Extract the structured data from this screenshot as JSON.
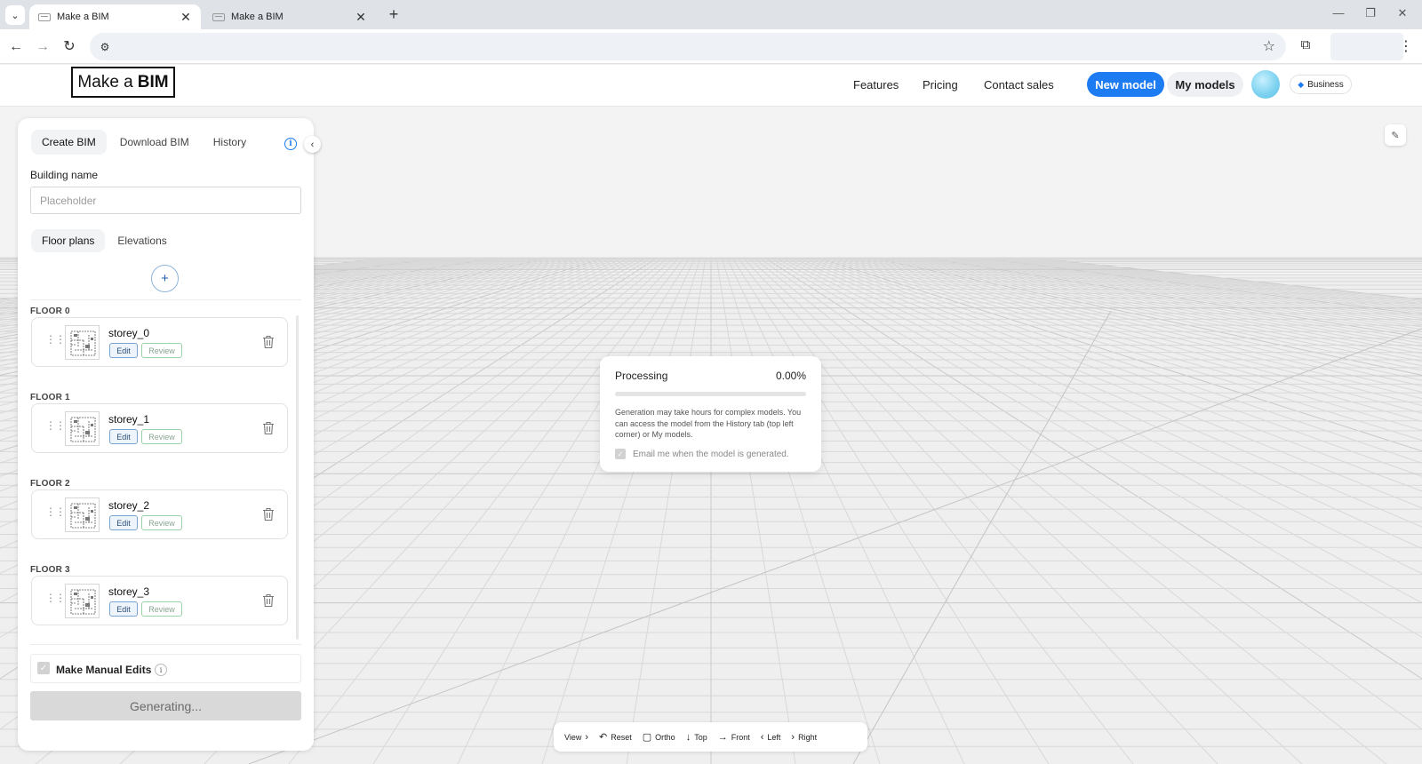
{
  "browser": {
    "tabs": [
      {
        "title": "Make a BIM",
        "active": true
      },
      {
        "title": "Make a BIM",
        "active": false
      }
    ]
  },
  "header": {
    "logo_text": "Make a",
    "logo_bold": "BIM",
    "nav": [
      "Features",
      "Pricing",
      "Contact sales"
    ],
    "new_model": "New model",
    "my_models": "My models",
    "plan_badge": "Business"
  },
  "panel": {
    "tabs": [
      "Create BIM",
      "Download BIM",
      "History"
    ],
    "active_tab": "Create BIM",
    "building_name_label": "Building name",
    "building_name_placeholder": "Placeholder",
    "building_name_value": "",
    "plan_tabs": [
      "Floor plans",
      "Elevations"
    ],
    "active_plan_tab": "Floor plans",
    "add_symbol": "+",
    "floors": [
      {
        "label": "FLOOR 0",
        "name": "storey_0",
        "edit": "Edit",
        "review": "Review"
      },
      {
        "label": "FLOOR 1",
        "name": "storey_1",
        "edit": "Edit",
        "review": "Review"
      },
      {
        "label": "FLOOR 2",
        "name": "storey_2",
        "edit": "Edit",
        "review": "Review"
      },
      {
        "label": "FLOOR 3",
        "name": "storey_3",
        "edit": "Edit",
        "review": "Review"
      }
    ],
    "manual_edits_label": "Make Manual Edits",
    "manual_edits_checked": true,
    "generate_button": "Generating..."
  },
  "processing": {
    "title": "Processing",
    "percent_text": "0.00%",
    "progress": 0,
    "message": "Generation may take hours for complex models. You can access the model from the History tab (top left corner) or My models.",
    "email_label": "Email me when the model is generated.",
    "email_checked": true
  },
  "toolbar": {
    "items": [
      {
        "label": "View",
        "icon": "chevron-right-icon"
      },
      {
        "label": "Reset",
        "icon": "undo-icon"
      },
      {
        "label": "Ortho",
        "icon": "square-icon"
      },
      {
        "label": "Top",
        "icon": "arrow-down-icon"
      },
      {
        "label": "Front",
        "icon": "arrow-right-icon"
      },
      {
        "label": "Left",
        "icon": "chevron-left-icon"
      },
      {
        "label": "Right",
        "icon": "chevron-right-icon"
      }
    ]
  },
  "colors": {
    "accent": "#1e7cf2",
    "panel_bg": "#ffffff",
    "viewport_bg": "#efefef"
  }
}
